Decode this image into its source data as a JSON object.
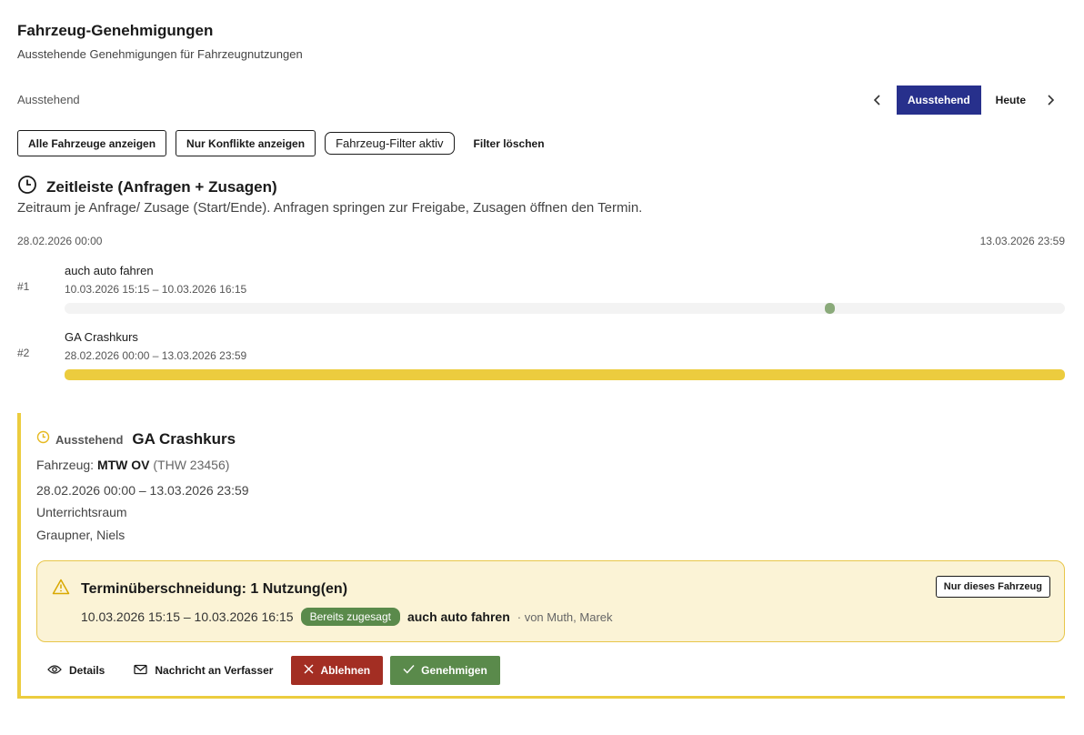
{
  "header": {
    "title": "Fahrzeug-Genehmigungen",
    "subtitle": "Ausstehende Genehmigungen für Fahrzeugnutzungen"
  },
  "section_label": "Ausstehend",
  "nav": {
    "active_label": "Ausstehend",
    "today_label": "Heute",
    "prev_icon": "chevron-left-icon",
    "next_icon": "chevron-right-icon"
  },
  "filters": {
    "all_vehicles": "Alle Fahrzeuge anzeigen",
    "conflicts_only": "Nur Konflikte anzeigen",
    "vehicle_filter_active": "Fahrzeug-Filter aktiv",
    "clear": "Filter löschen"
  },
  "timeline": {
    "title": "Zeitleiste (Anfragen + Zusagen)",
    "icon": "clock-icon",
    "description": "Zeitraum je Anfrage/ Zusage (Start/Ende). Anfragen springen zur Freigabe, Zusagen öffnen den Termin.",
    "start_label": "28.02.2026 00:00",
    "end_label": "13.03.2026 23:59",
    "axis_start": "2026-02-28T00:00",
    "axis_end": "2026-03-13T23:59",
    "rows": [
      {
        "index": "#1",
        "name": "auch auto fahren",
        "range": "10.03.2026 15:15 – 10.03.2026 16:15",
        "start": "2026-03-10T15:15",
        "end": "2026-03-10T16:15",
        "color": "#8aaa7a"
      },
      {
        "index": "#2",
        "name": "GA Crashkurs",
        "range": "28.02.2026 00:00 – 13.03.2026 23:59",
        "start": "2026-02-28T00:00",
        "end": "2026-03-13T23:59",
        "color": "#eccc3e"
      }
    ]
  },
  "card": {
    "status": "Ausstehend",
    "status_icon": "clock-icon",
    "title": "GA Crashkurs",
    "vehicle_label": "Fahrzeug:",
    "vehicle_name": "MTW OV",
    "vehicle_plate": "(THW 23456)",
    "range": "28.02.2026 00:00 – 13.03.2026 23:59",
    "location": "Unterrichtsraum",
    "person": "Graupner, Niels",
    "accent_color": "#eccc3e",
    "conflict": {
      "icon": "warning-icon",
      "title": "Terminüberschneidung: 1 Nutzung(en)",
      "only_vehicle": "Nur dieses Fahrzeug",
      "range": "10.03.2026 15:15 – 10.03.2026 16:15",
      "badge": "Bereits zugesagt",
      "name": "auch auto fahren",
      "by": "· von Muth, Marek"
    },
    "actions": {
      "details": "Details",
      "message": "Nachricht an Verfasser",
      "reject": "Ablehnen",
      "approve": "Genehmigen"
    }
  },
  "colors": {
    "primary": "#27308c",
    "reject": "#a32e23",
    "approve": "#5a8a4b",
    "pending": "#eccc3e"
  }
}
